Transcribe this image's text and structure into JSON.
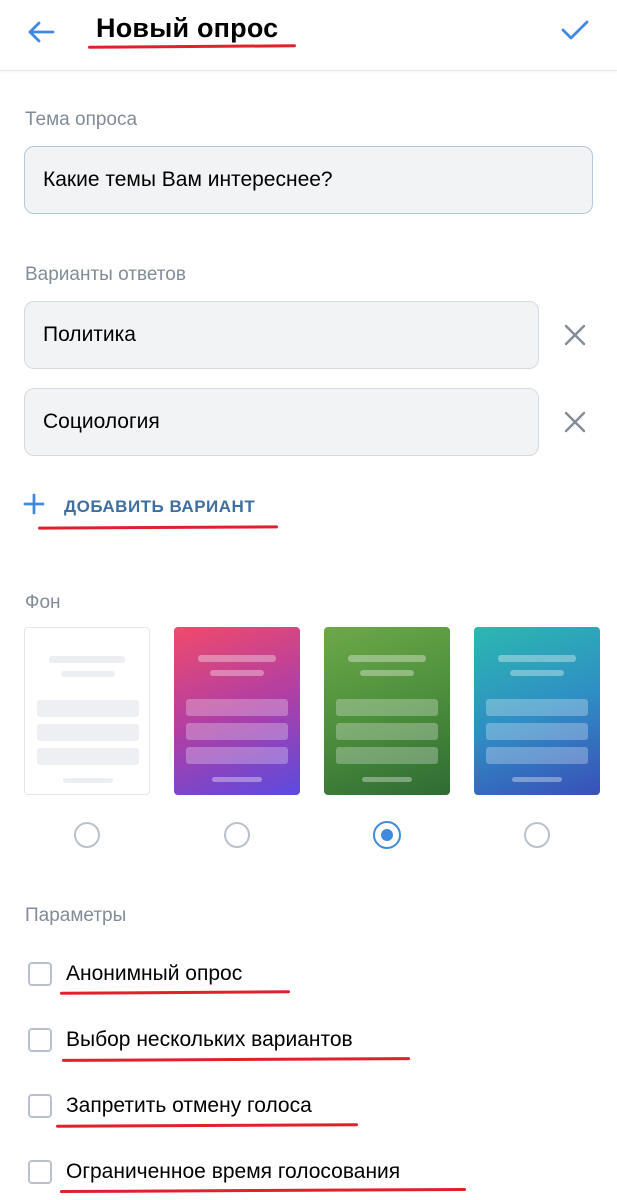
{
  "header": {
    "title": "Новый опрос",
    "back_icon": "arrow-left-icon",
    "done_icon": "checkmark-icon"
  },
  "topic": {
    "label": "Тема опроса",
    "value": "Какие темы Вам интереснее?"
  },
  "answers": {
    "label": "Варианты ответов",
    "items": [
      {
        "value": "Политика"
      },
      {
        "value": "Социология"
      }
    ],
    "remove_icon": "close-icon",
    "add_label": "ДОБАВИТЬ ВАРИАНТ"
  },
  "background": {
    "label": "Фон",
    "options": [
      {
        "style": "white",
        "selected": false
      },
      {
        "style": "pink-purple-gradient",
        "selected": false
      },
      {
        "style": "green-gradient",
        "selected": true
      },
      {
        "style": "teal-blue-gradient",
        "selected": false
      }
    ]
  },
  "params": {
    "label": "Параметры",
    "items": [
      {
        "label": "Анонимный опрос",
        "checked": false
      },
      {
        "label": "Выбор нескольких вариантов",
        "checked": false
      },
      {
        "label": "Запретить отмену голоса",
        "checked": false
      },
      {
        "label": "Ограниченное время голосования",
        "checked": false
      }
    ]
  },
  "colors": {
    "accent": "#3f8ae0",
    "annotation_underline": "#e0212d",
    "secondary_text": "#818c99"
  }
}
